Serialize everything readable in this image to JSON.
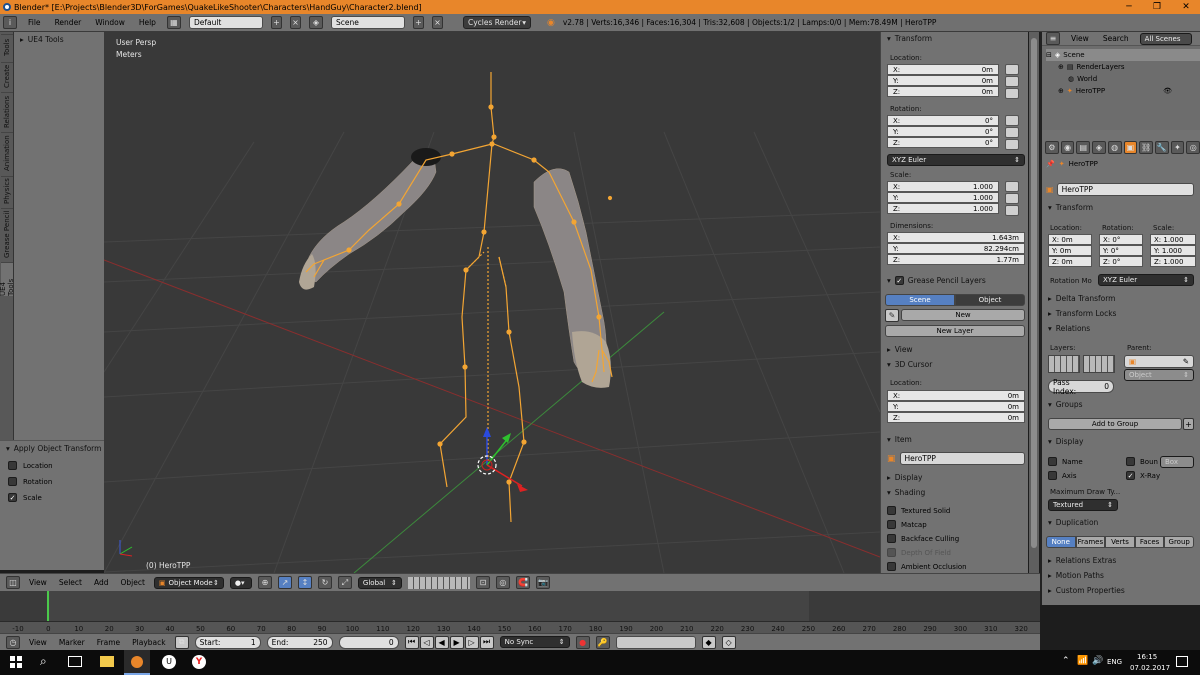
{
  "window": {
    "title": "Blender* [E:\\Projects\\Blender3D\\ForGames\\QuakeLikeShooter\\Characters\\HandGuy\\Character2.blend]",
    "minimize": "─",
    "maximize": "❐",
    "close": "✕"
  },
  "infobar": {
    "menus": [
      "File",
      "Render",
      "Window",
      "Help"
    ],
    "layout": "Default",
    "scene": "Scene",
    "engine": "Cycles Render",
    "stats": "v2.78 | Verts:16,346 | Faces:16,304 | Tris:32,608 | Objects:1/2 | Lamps:0/0 | Mem:78.49M | HeroTPP"
  },
  "vertical_tabs": [
    "Tools",
    "Create",
    "Relations",
    "Animation",
    "Physics",
    "Grease Pencil",
    "UE4 Tools"
  ],
  "tool_shelf": {
    "header": "UE4 Tools"
  },
  "operator_panel": {
    "title": "Apply Object Transform",
    "options": [
      {
        "label": "Location",
        "checked": false
      },
      {
        "label": "Rotation",
        "checked": false
      },
      {
        "label": "Scale",
        "checked": true
      }
    ]
  },
  "viewport": {
    "view_name": "User Persp",
    "units": "Meters",
    "object_label": "(0) HeroTPP"
  },
  "n_panel": {
    "transform_title": "Transform",
    "location_label": "Location:",
    "location": [
      {
        "axis": "X:",
        "value": "0m"
      },
      {
        "axis": "Y:",
        "value": "0m"
      },
      {
        "axis": "Z:",
        "value": "0m"
      }
    ],
    "rotation_label": "Rotation:",
    "rotation": [
      {
        "axis": "X:",
        "value": "0°"
      },
      {
        "axis": "Y:",
        "value": "0°"
      },
      {
        "axis": "Z:",
        "value": "0°"
      }
    ],
    "rotation_mode": "XYZ Euler",
    "scale_label": "Scale:",
    "scale": [
      {
        "axis": "X:",
        "value": "1.000"
      },
      {
        "axis": "Y:",
        "value": "1.000"
      },
      {
        "axis": "Z:",
        "value": "1.000"
      }
    ],
    "dimensions_label": "Dimensions:",
    "dimensions": [
      {
        "axis": "X:",
        "value": "1.643m"
      },
      {
        "axis": "Y:",
        "value": "82.294cm"
      },
      {
        "axis": "Z:",
        "value": "1.77m"
      }
    ],
    "grease_title": "Grease Pencil Layers",
    "grease_scene": "Scene",
    "grease_object": "Object",
    "grease_new": "New",
    "grease_new_layer": "New Layer",
    "view_title": "View",
    "cursor_title": "3D Cursor",
    "cursor_location_label": "Location:",
    "cursor": [
      {
        "axis": "X:",
        "value": "0m"
      },
      {
        "axis": "Y:",
        "value": "0m"
      },
      {
        "axis": "Z:",
        "value": "0m"
      }
    ],
    "item_title": "Item",
    "item_name": "HeroTPP",
    "display_title": "Display",
    "shading_title": "Shading",
    "shading_options": [
      "Textured Solid",
      "Matcap",
      "Backface Culling",
      "Depth Of Field",
      "Ambient Occlusion"
    ]
  },
  "outliner": {
    "tabs": [
      "View",
      "Search",
      "All Scenes"
    ],
    "tree": [
      {
        "label": "Scene",
        "indent": 0
      },
      {
        "label": "RenderLayers",
        "indent": 1
      },
      {
        "label": "World",
        "indent": 1
      },
      {
        "label": "HeroTPP",
        "indent": 1
      }
    ]
  },
  "properties": {
    "breadcrumb": "HeroTPP",
    "object_name": "HeroTPP",
    "transform_title": "Transform",
    "location_label": "Location:",
    "rotation_label": "Rotation:",
    "scale_label": "Scale:",
    "location": [
      "X:    0m",
      "Y:    0m",
      "Z:    0m"
    ],
    "rotation": [
      "X:    0°",
      "Y:    0°",
      "Z:    0°"
    ],
    "scale": [
      "X: 1.000",
      "Y: 1.000",
      "Z: 1.000"
    ],
    "rotation_mode_label": "Rotation Mo",
    "rotation_mode": "XYZ Euler",
    "delta_transform": "Delta Transform",
    "transform_locks": "Transform Locks",
    "relations": "Relations",
    "layers_label": "Layers:",
    "parent_label": "Parent:",
    "parent_type": "Object",
    "pass_index_label": "Pass Index:",
    "pass_index": "0",
    "groups": "Groups",
    "add_to_group": "Add to Group",
    "display": "Display",
    "name_opt": "Name",
    "axis_opt": "Axis",
    "bounds_opt": "Boun",
    "bounds_type": "Box",
    "xray_opt": "X-Ray",
    "max_draw_label": "Maximum Draw Ty...",
    "max_draw": "Textured",
    "duplication": "Duplication",
    "dup_tabs": [
      "None",
      "Frames",
      "Verts",
      "Faces",
      "Group"
    ],
    "relations_extras": "Relations Extras",
    "motion_paths": "Motion Paths",
    "custom_properties": "Custom Properties"
  },
  "view3d_header": {
    "menus": [
      "View",
      "Select",
      "Add",
      "Object"
    ],
    "mode": "Object Mode",
    "orientation": "Global"
  },
  "timeline": {
    "ticks": [
      "-10",
      "0",
      "10",
      "20",
      "30",
      "40",
      "50",
      "60",
      "70",
      "80",
      "90",
      "100",
      "110",
      "120",
      "130",
      "140",
      "150",
      "160",
      "170",
      "180",
      "190",
      "200",
      "210",
      "220",
      "230",
      "240",
      "250",
      "260",
      "270",
      "280",
      "290",
      "300",
      "310",
      "320"
    ],
    "menus": [
      "View",
      "Marker",
      "Frame",
      "Playback"
    ],
    "start_label": "Start:",
    "start": "1",
    "end_label": "End:",
    "end": "250",
    "current": "0",
    "sync": "No Sync"
  },
  "taskbar": {
    "language": "ENG",
    "time": "16:15",
    "date": "07.02.2017"
  },
  "colors": {
    "accent": "#e8862a",
    "selection_blue": "#5680c2",
    "viewport_bg": "#393939",
    "armature": "#f3a533"
  }
}
